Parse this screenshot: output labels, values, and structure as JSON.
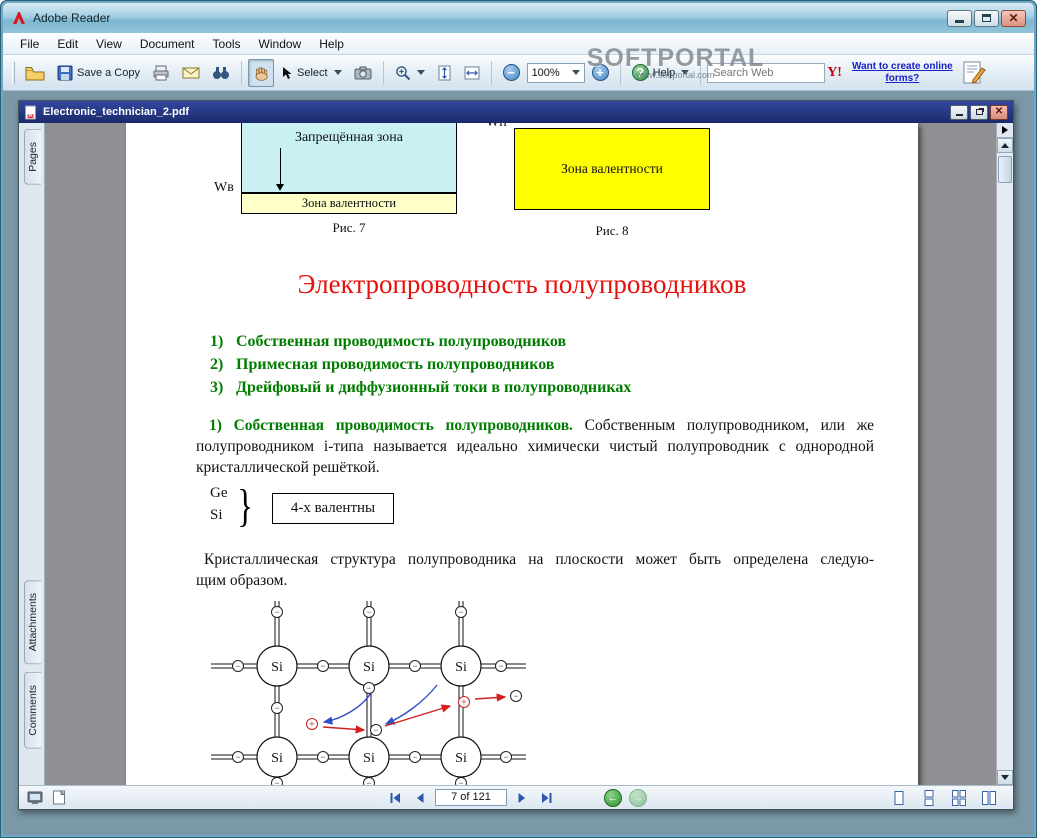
{
  "app": {
    "title": "Adobe Reader",
    "menu_items": [
      "File",
      "Edit",
      "View",
      "Document",
      "Tools",
      "Window",
      "Help"
    ],
    "toolbar": {
      "save_label": "Save a Copy",
      "select_label": "Select",
      "zoom_value": "100%",
      "help_label": "Help",
      "search_placeholder": "Search Web",
      "yahoo_label": "Y!",
      "forms_link_line1": "Want to create online",
      "forms_link_line2": "forms?"
    },
    "watermark": {
      "title": "SOFTPORTAL",
      "url": "www.softportal.com"
    }
  },
  "doc_window": {
    "title": "Electronic_technician_2.pdf",
    "tabs": [
      {
        "label": "Pages"
      },
      {
        "label": "Attachments"
      },
      {
        "label": "Comments"
      }
    ],
    "statusbar": {
      "page_indicator": "7 of 121"
    }
  },
  "document": {
    "fig7": {
      "upper_band": "Запрещённая зона",
      "lower_band": "Зона валентности",
      "axis_label": "Wв",
      "caption": "Рис. 7"
    },
    "fig8": {
      "band": "Зона валентности",
      "axis_label": "Wп",
      "caption": "Рис. 8"
    },
    "heading": "Электропроводность полупроводников",
    "outline": [
      {
        "num": "1)",
        "text": "Собственная проводимость полупроводников"
      },
      {
        "num": "2)",
        "text": "Примесная проводимость полупроводников"
      },
      {
        "num": "3)",
        "text": "Дрейфовый и диффузионный токи в полупроводниках"
      }
    ],
    "para1_lead": "1)  Собственная проводимость полупроводников.",
    "para1_body": " Собственным полупроводником, или же полупроводником i-типа называется идеально химически чистый полупроводник с однородной кристаллической решёткой.",
    "elements": {
      "line1": "Ge",
      "line2": "Si",
      "box_label": "4-х валентны"
    },
    "para2_line1": "Кристаллическая структура полупроводника на плоскости может быть определена следую-",
    "para2_line2": "щим образом.",
    "lattice": {
      "atom_label": "Si",
      "electron": "−",
      "hole": "+"
    }
  }
}
